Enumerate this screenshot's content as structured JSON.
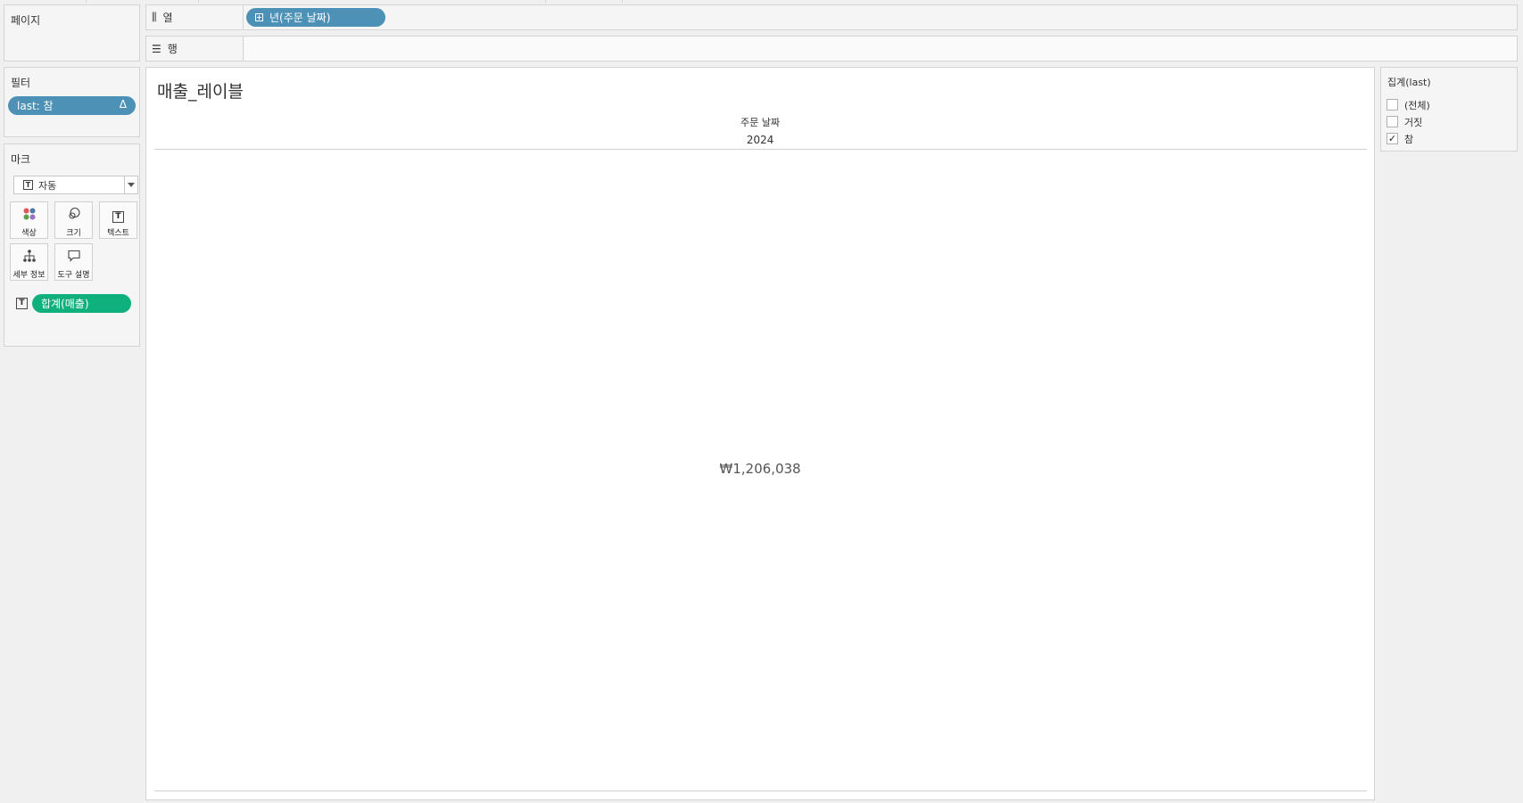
{
  "pages_card": {
    "title": "페이지"
  },
  "columns_shelf": {
    "label": "열",
    "icon": "columns-icon",
    "pill": "년(주문 날짜)"
  },
  "rows_shelf": {
    "label": "행",
    "icon": "rows-icon"
  },
  "filters_card": {
    "title": "필터",
    "pill": "last: 참",
    "pill_icon": "delta-icon"
  },
  "marks_card": {
    "title": "마크",
    "mark_type": "자동",
    "buttons": [
      {
        "label": "색상",
        "icon": "color-icon"
      },
      {
        "label": "크기",
        "icon": "size-icon"
      },
      {
        "label": "텍스트",
        "icon": "text-icon"
      },
      {
        "label": "세부 정보",
        "icon": "detail-icon"
      },
      {
        "label": "도구 설명",
        "icon": "tooltip-icon"
      }
    ],
    "text_field": "합계(매출)"
  },
  "view": {
    "title": "매출_레이블",
    "header_field": "주문 날짜",
    "header_year": "2024",
    "value": "₩1,206,038"
  },
  "legend_filter": {
    "title": "집계(last)",
    "items": [
      {
        "label": "(전체)",
        "checked": false,
        "mark": ""
      },
      {
        "label": "거짓",
        "checked": false,
        "mark": ""
      },
      {
        "label": "참",
        "checked": true,
        "mark": "✓"
      }
    ]
  },
  "colors": {
    "dimension_pill": "#4d92b6",
    "measure_pill": "#0fb07b",
    "panel_bg": "#f5f5f5"
  }
}
